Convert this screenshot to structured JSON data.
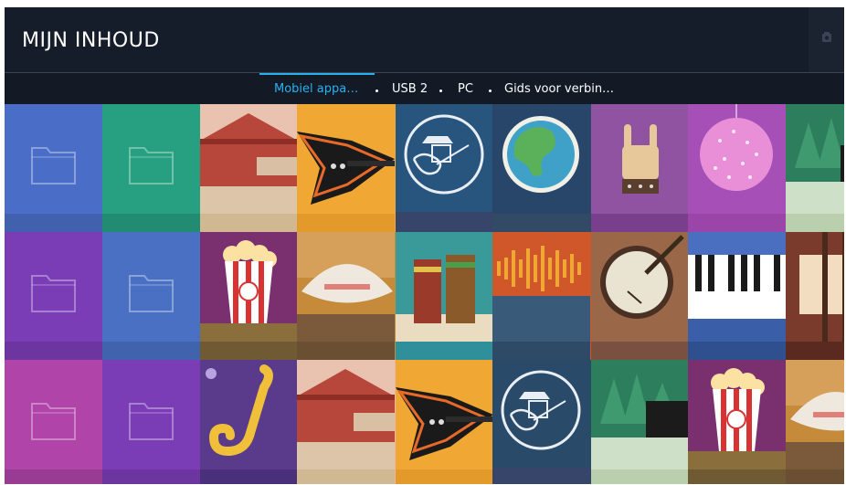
{
  "header": {
    "title": "MIJN INHOUD",
    "settings_icon": "gear-icon"
  },
  "tabs": [
    {
      "label": "Mobiel appa…",
      "active": true
    },
    {
      "label": "USB 2",
      "active": false
    },
    {
      "label": "PC",
      "active": false
    },
    {
      "label": "Gids voor verbin…",
      "active": false
    }
  ],
  "colors": {
    "accent": "#27b2ef",
    "background": "#121a27"
  },
  "tiles": [
    {
      "row": 0,
      "col": 0,
      "icon": "folder-icon",
      "color": "#4a6ec7"
    },
    {
      "row": 0,
      "col": 1,
      "icon": "folder-icon",
      "color": "#27a082"
    },
    {
      "row": 0,
      "col": 2,
      "icon": "barn-icon",
      "color": "#e7b7a7"
    },
    {
      "row": 0,
      "col": 3,
      "icon": "electric-guitar-icon",
      "color": "#f0a733"
    },
    {
      "row": 0,
      "col": 4,
      "icon": "guitar-player-icon",
      "color": "#28557d"
    },
    {
      "row": 0,
      "col": 5,
      "icon": "globe-icon",
      "color": "#2a4a6a"
    },
    {
      "row": 0,
      "col": 6,
      "icon": "rock-hand-icon",
      "color": "#8a4a9c"
    },
    {
      "row": 0,
      "col": 7,
      "icon": "disco-ball-icon",
      "color": "#a64fb7"
    },
    {
      "row": 0,
      "col": 8,
      "icon": "piano-forest-icon",
      "color": "#2d7e5c"
    },
    {
      "row": 1,
      "col": 0,
      "icon": "folder-icon",
      "color": "#7b3db6"
    },
    {
      "row": 1,
      "col": 1,
      "icon": "folder-icon",
      "color": "#4a70c4"
    },
    {
      "row": 1,
      "col": 2,
      "icon": "popcorn-icon",
      "color": "#7a2f6f"
    },
    {
      "row": 1,
      "col": 3,
      "icon": "cowboy-hat-icon",
      "color": "#c68a3b"
    },
    {
      "row": 1,
      "col": 4,
      "icon": "bongo-drums-icon",
      "color": "#3a9a9a"
    },
    {
      "row": 1,
      "col": 5,
      "icon": "sound-wave-icon",
      "color": "#d0572a"
    },
    {
      "row": 1,
      "col": 6,
      "icon": "banjo-icon",
      "color": "#9a6848"
    },
    {
      "row": 1,
      "col": 7,
      "icon": "keyboard-icon",
      "color": "#4a6fc0"
    },
    {
      "row": 1,
      "col": 8,
      "icon": "piano-keys-icon",
      "color": "#7a3b2d"
    },
    {
      "row": 2,
      "col": 0,
      "icon": "folder-icon",
      "color": "#b044a8"
    },
    {
      "row": 2,
      "col": 1,
      "icon": "folder-icon",
      "color": "#7b3db6"
    },
    {
      "row": 2,
      "col": 2,
      "icon": "saxophone-icon",
      "color": "#5a3a8a"
    },
    {
      "row": 2,
      "col": 3,
      "icon": "barn-icon",
      "color": "#e7b7a7"
    },
    {
      "row": 2,
      "col": 4,
      "icon": "electric-guitar-icon",
      "color": "#f0a733"
    },
    {
      "row": 2,
      "col": 5,
      "icon": "guitar-player-icon",
      "color": "#2a4a6a"
    },
    {
      "row": 2,
      "col": 6,
      "icon": "piano-forest-icon",
      "color": "#2d7e5c"
    },
    {
      "row": 2,
      "col": 7,
      "icon": "popcorn-icon",
      "color": "#7a2f6f"
    },
    {
      "row": 2,
      "col": 8,
      "icon": "cowboy-hat-icon",
      "color": "#c68a3b"
    }
  ]
}
